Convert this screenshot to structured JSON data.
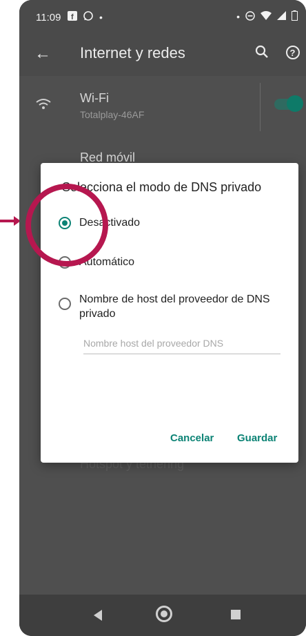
{
  "status_bar": {
    "time": "11:09",
    "icons_left": [
      "facebook-icon",
      "whatsapp-icon",
      "dot"
    ],
    "icons_right": [
      "dot",
      "do-not-disturb-icon",
      "wifi-icon",
      "signal-icon",
      "battery-icon"
    ]
  },
  "app_bar": {
    "title": "Internet y redes"
  },
  "settings": {
    "wifi": {
      "title": "Wi-Fi",
      "subtitle": "Totalplay-46AF",
      "enabled": true
    },
    "mobile": {
      "title": "Red móvil"
    },
    "hidden_row": {
      "title": "Hotspot y tethering"
    }
  },
  "dialog": {
    "title": "Selecciona el modo de DNS privado",
    "options": [
      {
        "label": "Desactivado",
        "checked": true
      },
      {
        "label": "Automático",
        "checked": false
      },
      {
        "label": "Nombre de host del proveedor de DNS privado",
        "checked": false
      }
    ],
    "input_placeholder": "Nombre host del proveedor DNS",
    "input_value": "",
    "cancel_label": "Cancelar",
    "save_label": "Guardar"
  },
  "colors": {
    "accent": "#0c8375",
    "annotation": "#b6174f",
    "scrim": "#4f4f4f"
  }
}
